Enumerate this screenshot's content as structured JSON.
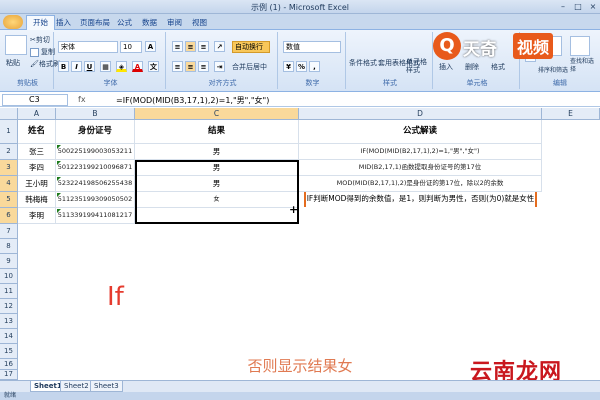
{
  "window": {
    "title": "示例 (1) - Microsoft Excel"
  },
  "tabs": [
    "开始",
    "插入",
    "页面布局",
    "公式",
    "数据",
    "审阅",
    "视图"
  ],
  "ribbon": {
    "clipboard": {
      "paste": "粘贴",
      "cut": "剪切",
      "copy": "复制",
      "format_painter": "格式刷",
      "label": "剪贴板"
    },
    "font": {
      "name": "宋体",
      "size": "10",
      "label": "字体"
    },
    "alignment": {
      "wrap": "自动换行",
      "merge": "合并后居中",
      "label": "对齐方式"
    },
    "number": {
      "format": "数值",
      "label": "数字"
    },
    "styles": {
      "conditional": "条件格式",
      "table": "套用表格格式",
      "cell": "单元格样式",
      "label": "样式"
    },
    "cells": {
      "insert": "插入",
      "delete": "删除",
      "format": "格式",
      "label": "单元格"
    },
    "editing": {
      "sort": "排序和筛选",
      "find": "查找和选择",
      "label": "编辑"
    }
  },
  "logo": {
    "mark": "Q",
    "text": "天奇",
    "box": "视频"
  },
  "formula_bar": {
    "name_box": "C3",
    "fx": "fx",
    "formula": "=IF(MOD(MID(B3,17,1),2)=1,\"男\",\"女\")"
  },
  "columns": [
    "A",
    "B",
    "C",
    "D",
    "E"
  ],
  "rows": [
    "1",
    "2",
    "3",
    "4",
    "5",
    "6",
    "7",
    "8",
    "9",
    "10",
    "11",
    "12",
    "13",
    "14",
    "15",
    "16",
    "17"
  ],
  "table": {
    "headers": {
      "name": "姓名",
      "id": "身份证号",
      "result": "结果",
      "explain": "公式解读"
    },
    "records": [
      {
        "name": "张三",
        "id": "500225199003053211",
        "result": "男",
        "explain": "IF(MOD(MID(B2,17,1),2)=1,\"男\",\"女\")"
      },
      {
        "name": "李四",
        "id": "501223199210096871",
        "result": "男",
        "explain": "MID(B2,17,1)函数提取身份证号的第17位"
      },
      {
        "name": "王小明",
        "id": "523224198506255438",
        "result": "男",
        "explain": "MOD(MID(B2,17,1),2)是身份证的第17位，除以2的余数"
      },
      {
        "name": "韩梅梅",
        "id": "511235199309050502",
        "result": "女",
        "explain": "IF判断MOD得到的余数值，是1，则判断为男性，否则(为0)就是女性"
      },
      {
        "name": "李明",
        "id": "511339199411081217",
        "result": "",
        "explain": ""
      }
    ]
  },
  "overlay": {
    "big_text": "If",
    "caption": "否则显示结果女",
    "watermark": "云南龙网"
  },
  "sheets": [
    "Sheet1",
    "Sheet2",
    "Sheet3"
  ],
  "status": "就绪"
}
